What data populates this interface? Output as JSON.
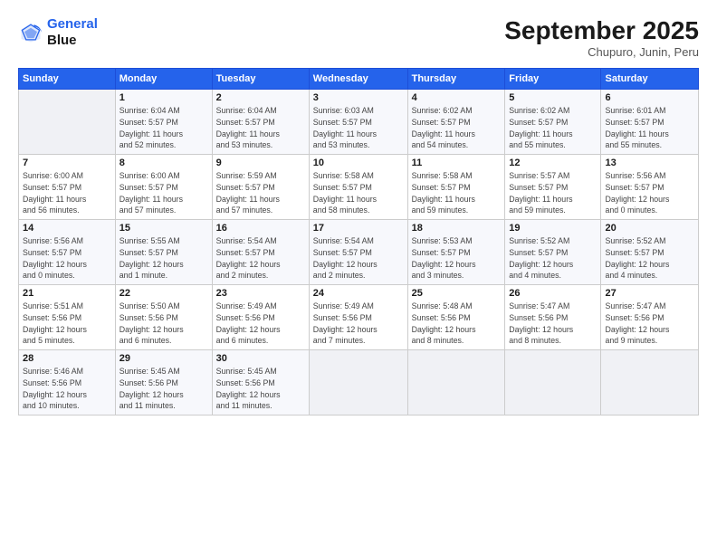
{
  "header": {
    "logo_line1": "General",
    "logo_line2": "Blue",
    "title": "September 2025",
    "subtitle": "Chupuro, Junin, Peru"
  },
  "calendar": {
    "columns": [
      "Sunday",
      "Monday",
      "Tuesday",
      "Wednesday",
      "Thursday",
      "Friday",
      "Saturday"
    ],
    "weeks": [
      [
        {
          "day": "",
          "info": ""
        },
        {
          "day": "1",
          "info": "Sunrise: 6:04 AM\nSunset: 5:57 PM\nDaylight: 11 hours\nand 52 minutes."
        },
        {
          "day": "2",
          "info": "Sunrise: 6:04 AM\nSunset: 5:57 PM\nDaylight: 11 hours\nand 53 minutes."
        },
        {
          "day": "3",
          "info": "Sunrise: 6:03 AM\nSunset: 5:57 PM\nDaylight: 11 hours\nand 53 minutes."
        },
        {
          "day": "4",
          "info": "Sunrise: 6:02 AM\nSunset: 5:57 PM\nDaylight: 11 hours\nand 54 minutes."
        },
        {
          "day": "5",
          "info": "Sunrise: 6:02 AM\nSunset: 5:57 PM\nDaylight: 11 hours\nand 55 minutes."
        },
        {
          "day": "6",
          "info": "Sunrise: 6:01 AM\nSunset: 5:57 PM\nDaylight: 11 hours\nand 55 minutes."
        }
      ],
      [
        {
          "day": "7",
          "info": "Sunrise: 6:00 AM\nSunset: 5:57 PM\nDaylight: 11 hours\nand 56 minutes."
        },
        {
          "day": "8",
          "info": "Sunrise: 6:00 AM\nSunset: 5:57 PM\nDaylight: 11 hours\nand 57 minutes."
        },
        {
          "day": "9",
          "info": "Sunrise: 5:59 AM\nSunset: 5:57 PM\nDaylight: 11 hours\nand 57 minutes."
        },
        {
          "day": "10",
          "info": "Sunrise: 5:58 AM\nSunset: 5:57 PM\nDaylight: 11 hours\nand 58 minutes."
        },
        {
          "day": "11",
          "info": "Sunrise: 5:58 AM\nSunset: 5:57 PM\nDaylight: 11 hours\nand 59 minutes."
        },
        {
          "day": "12",
          "info": "Sunrise: 5:57 AM\nSunset: 5:57 PM\nDaylight: 11 hours\nand 59 minutes."
        },
        {
          "day": "13",
          "info": "Sunrise: 5:56 AM\nSunset: 5:57 PM\nDaylight: 12 hours\nand 0 minutes."
        }
      ],
      [
        {
          "day": "14",
          "info": "Sunrise: 5:56 AM\nSunset: 5:57 PM\nDaylight: 12 hours\nand 0 minutes."
        },
        {
          "day": "15",
          "info": "Sunrise: 5:55 AM\nSunset: 5:57 PM\nDaylight: 12 hours\nand 1 minute."
        },
        {
          "day": "16",
          "info": "Sunrise: 5:54 AM\nSunset: 5:57 PM\nDaylight: 12 hours\nand 2 minutes."
        },
        {
          "day": "17",
          "info": "Sunrise: 5:54 AM\nSunset: 5:57 PM\nDaylight: 12 hours\nand 2 minutes."
        },
        {
          "day": "18",
          "info": "Sunrise: 5:53 AM\nSunset: 5:57 PM\nDaylight: 12 hours\nand 3 minutes."
        },
        {
          "day": "19",
          "info": "Sunrise: 5:52 AM\nSunset: 5:57 PM\nDaylight: 12 hours\nand 4 minutes."
        },
        {
          "day": "20",
          "info": "Sunrise: 5:52 AM\nSunset: 5:57 PM\nDaylight: 12 hours\nand 4 minutes."
        }
      ],
      [
        {
          "day": "21",
          "info": "Sunrise: 5:51 AM\nSunset: 5:56 PM\nDaylight: 12 hours\nand 5 minutes."
        },
        {
          "day": "22",
          "info": "Sunrise: 5:50 AM\nSunset: 5:56 PM\nDaylight: 12 hours\nand 6 minutes."
        },
        {
          "day": "23",
          "info": "Sunrise: 5:49 AM\nSunset: 5:56 PM\nDaylight: 12 hours\nand 6 minutes."
        },
        {
          "day": "24",
          "info": "Sunrise: 5:49 AM\nSunset: 5:56 PM\nDaylight: 12 hours\nand 7 minutes."
        },
        {
          "day": "25",
          "info": "Sunrise: 5:48 AM\nSunset: 5:56 PM\nDaylight: 12 hours\nand 8 minutes."
        },
        {
          "day": "26",
          "info": "Sunrise: 5:47 AM\nSunset: 5:56 PM\nDaylight: 12 hours\nand 8 minutes."
        },
        {
          "day": "27",
          "info": "Sunrise: 5:47 AM\nSunset: 5:56 PM\nDaylight: 12 hours\nand 9 minutes."
        }
      ],
      [
        {
          "day": "28",
          "info": "Sunrise: 5:46 AM\nSunset: 5:56 PM\nDaylight: 12 hours\nand 10 minutes."
        },
        {
          "day": "29",
          "info": "Sunrise: 5:45 AM\nSunset: 5:56 PM\nDaylight: 12 hours\nand 11 minutes."
        },
        {
          "day": "30",
          "info": "Sunrise: 5:45 AM\nSunset: 5:56 PM\nDaylight: 12 hours\nand 11 minutes."
        },
        {
          "day": "",
          "info": ""
        },
        {
          "day": "",
          "info": ""
        },
        {
          "day": "",
          "info": ""
        },
        {
          "day": "",
          "info": ""
        }
      ]
    ]
  }
}
